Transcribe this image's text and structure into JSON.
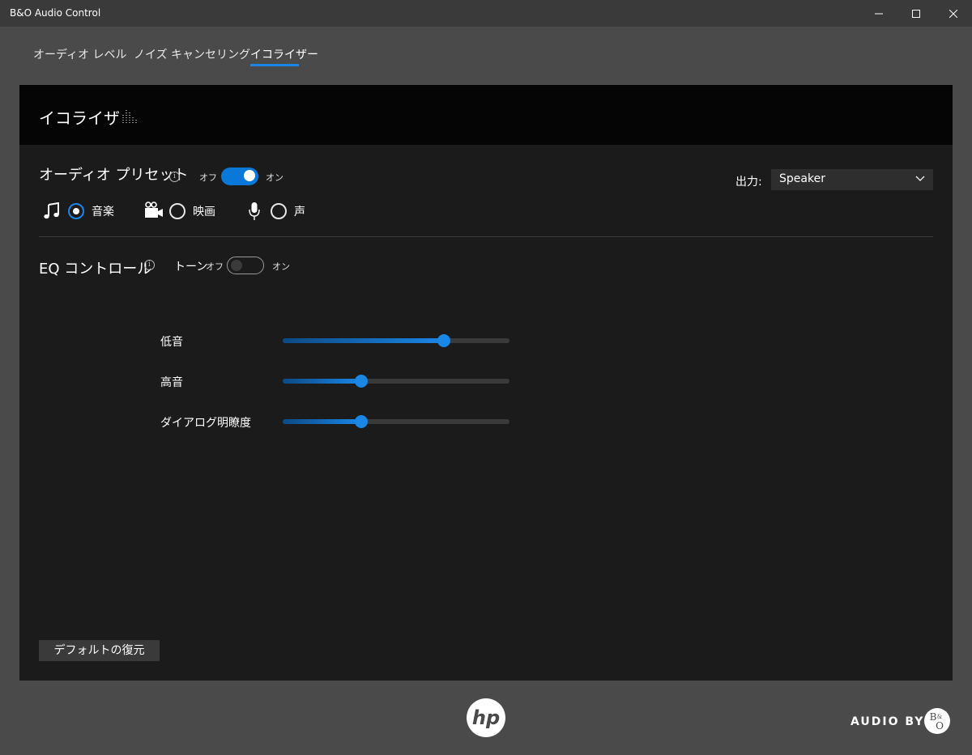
{
  "window": {
    "title": "B&O Audio Control"
  },
  "tabs": [
    {
      "label": "オーディオ レベル"
    },
    {
      "label": "ノイズ キャンセリング"
    },
    {
      "label": "イコライザー"
    }
  ],
  "active_tab": 2,
  "panel": {
    "title": "イコライザ"
  },
  "audio_preset": {
    "title": "オーディオ プリセット",
    "off_label": "オフ",
    "on_label": "オン",
    "enabled": true,
    "options": [
      {
        "label": "音楽",
        "icon": "music-note-icon",
        "selected": true
      },
      {
        "label": "映画",
        "icon": "video-camera-icon",
        "selected": false
      },
      {
        "label": "声",
        "icon": "microphone-icon",
        "selected": false
      }
    ]
  },
  "output": {
    "label": "出力:",
    "value": "Speaker"
  },
  "eq_control": {
    "title": "EQ コントロール",
    "tone_label": "トーン",
    "off_label": "オフ",
    "on_label": "オン",
    "tone_enabled": false,
    "sliders": [
      {
        "label": "低音",
        "fraction": 0.71
      },
      {
        "label": "高音",
        "fraction": 0.345
      },
      {
        "label": "ダイアログ明瞭度",
        "fraction": 0.345
      }
    ]
  },
  "reset_button": {
    "label": "デフォルトの復元"
  },
  "footer": {
    "audio_by": "AUDIO BY"
  },
  "colors": {
    "accent": "#1a86e6",
    "window_bg": "#4a4a4a",
    "panel_bg": "#1b1b1b",
    "header_bg": "#050505"
  }
}
